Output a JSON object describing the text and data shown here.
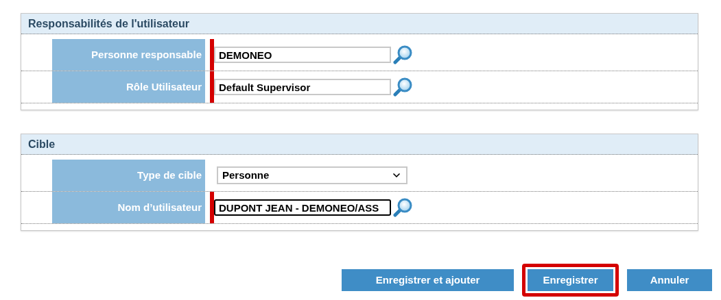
{
  "sections": [
    {
      "title": "Responsabilités de l'utilisateur",
      "fields": [
        {
          "kind": "lookup",
          "label": "Personne responsable",
          "value": "DEMONEO",
          "required": true,
          "focused": false
        },
        {
          "kind": "lookup",
          "label": "Rôle Utilisateur",
          "value": "Default Supervisor",
          "required": true,
          "focused": false
        }
      ]
    },
    {
      "title": "Cible",
      "fields": [
        {
          "kind": "select",
          "label": "Type de cible",
          "value": "Personne",
          "required": false
        },
        {
          "kind": "lookup",
          "label": "Nom d’utilisateur",
          "value": "DUPONT JEAN - DEMONEO/ASS",
          "required": true,
          "focused": true
        }
      ]
    }
  ],
  "buttons": [
    {
      "label": "Enregistrer et ajouter",
      "highlighted": false
    },
    {
      "label": "Enregistrer",
      "highlighted": true
    },
    {
      "label": "Annuler",
      "highlighted": false
    }
  ]
}
